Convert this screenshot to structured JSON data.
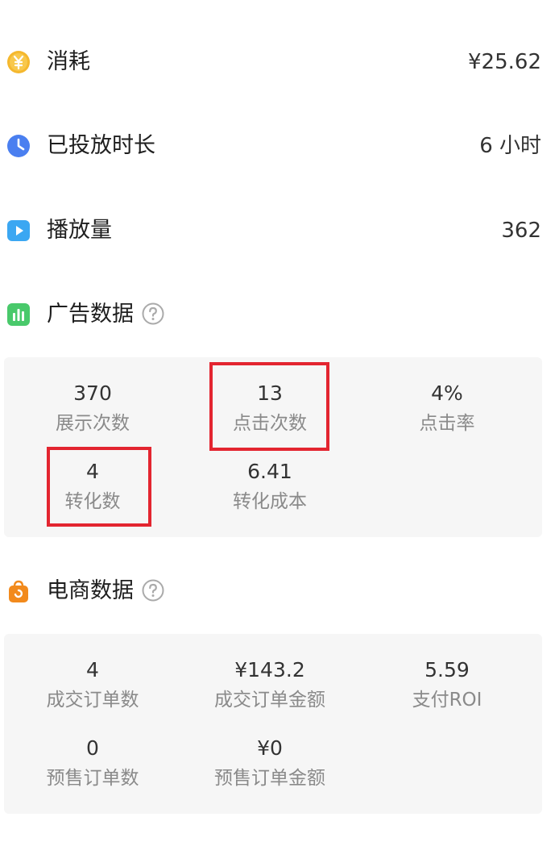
{
  "summary": {
    "spend": {
      "icon": "yuan-coin-icon",
      "label": "消耗",
      "value": "¥25.62"
    },
    "duration": {
      "icon": "clock-icon",
      "label": "已投放时长",
      "value": "6 小时"
    },
    "plays": {
      "icon": "play-icon",
      "label": "播放量",
      "value": "362"
    }
  },
  "ad_section": {
    "icon": "bar-chart-icon",
    "title": "广告数据",
    "help_icon": "question-mark-icon",
    "metrics": [
      {
        "value": "370",
        "label": "展示次数"
      },
      {
        "value": "13",
        "label": "点击次数",
        "highlighted": true
      },
      {
        "value": "4%",
        "label": "点击率"
      },
      {
        "value": "4",
        "label": "转化数",
        "highlighted": true
      },
      {
        "value": "6.41",
        "label": "转化成本"
      }
    ]
  },
  "ecom_section": {
    "icon": "shopping-bag-icon",
    "title": "电商数据",
    "help_icon": "question-mark-icon",
    "metrics": [
      {
        "value": "4",
        "label": "成交订单数"
      },
      {
        "value": "¥143.2",
        "label": "成交订单金额"
      },
      {
        "value": "5.59",
        "label": "支付ROI"
      },
      {
        "value": "0",
        "label": "预售订单数"
      },
      {
        "value": "¥0",
        "label": "预售订单金额"
      }
    ]
  },
  "colors": {
    "highlight": "#e32530",
    "panel_bg": "#f6f6f6",
    "coin": "#f5b82e",
    "clock": "#4a7ff0",
    "play": "#3ba7f2",
    "chart": "#49c96b",
    "bag": "#f28a1c"
  }
}
